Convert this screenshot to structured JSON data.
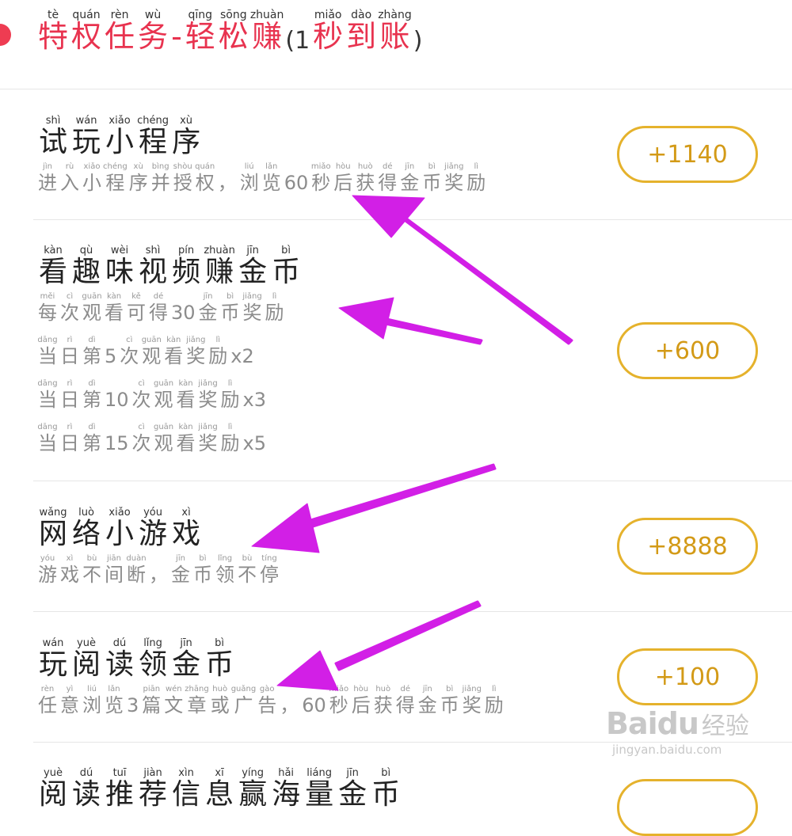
{
  "header": {
    "title_chars": [
      {
        "py": "tè",
        "hz": "特"
      },
      {
        "py": "quán",
        "hz": "权"
      },
      {
        "py": "rèn",
        "hz": "任"
      },
      {
        "py": "wù",
        "hz": "务"
      },
      {
        "py": "",
        "hz": "-"
      },
      {
        "py": "qīng",
        "hz": "轻"
      },
      {
        "py": "sōng",
        "hz": "松"
      },
      {
        "py": "zhuàn",
        "hz": "赚"
      }
    ],
    "tail_open": "(1",
    "tail_chars": [
      {
        "py": "miǎo",
        "hz": "秒"
      },
      {
        "py": "dào",
        "hz": "到"
      },
      {
        "py": "zhàng",
        "hz": "账"
      }
    ],
    "tail_close": ")"
  },
  "tasks": [
    {
      "title_chars": [
        {
          "py": "shì",
          "hz": "试"
        },
        {
          "py": "wán",
          "hz": "玩"
        },
        {
          "py": "xiǎo",
          "hz": "小"
        },
        {
          "py": "chéng",
          "hz": "程"
        },
        {
          "py": "xù",
          "hz": "序"
        }
      ],
      "desc_lines": [
        [
          {
            "py": "jìn",
            "hz": "进"
          },
          {
            "py": "rù",
            "hz": "入"
          },
          {
            "py": "xiǎo",
            "hz": "小"
          },
          {
            "py": "chéng",
            "hz": "程"
          },
          {
            "py": "xù",
            "hz": "序"
          },
          {
            "py": "bìng",
            "hz": "并"
          },
          {
            "py": "shòu",
            "hz": "授"
          },
          {
            "py": "quán",
            "hz": "权"
          },
          {
            "py": "",
            "hz": "，"
          },
          {
            "py": "liú",
            "hz": "浏"
          },
          {
            "py": "lǎn",
            "hz": "览"
          },
          {
            "py": "",
            "hz": "60"
          },
          {
            "py": "miǎo",
            "hz": "秒"
          },
          {
            "py": "hòu",
            "hz": "后"
          },
          {
            "py": "huò",
            "hz": "获"
          },
          {
            "py": "dé",
            "hz": "得"
          },
          {
            "py": "jīn",
            "hz": "金"
          },
          {
            "py": "bì",
            "hz": "币"
          },
          {
            "py": "jiǎng",
            "hz": "奖"
          },
          {
            "py": "lì",
            "hz": "励"
          }
        ]
      ],
      "reward": "+1140"
    },
    {
      "title_chars": [
        {
          "py": "kàn",
          "hz": "看"
        },
        {
          "py": "qù",
          "hz": "趣"
        },
        {
          "py": "wèi",
          "hz": "味"
        },
        {
          "py": "shì",
          "hz": "视"
        },
        {
          "py": "pín",
          "hz": "频"
        },
        {
          "py": "zhuàn",
          "hz": "赚"
        },
        {
          "py": "jīn",
          "hz": "金"
        },
        {
          "py": "bì",
          "hz": "币"
        }
      ],
      "desc_lines": [
        [
          {
            "py": "měi",
            "hz": "每"
          },
          {
            "py": "cì",
            "hz": "次"
          },
          {
            "py": "guān",
            "hz": "观"
          },
          {
            "py": "kàn",
            "hz": "看"
          },
          {
            "py": "kě",
            "hz": "可"
          },
          {
            "py": "dé",
            "hz": "得"
          },
          {
            "py": "",
            "hz": "30"
          },
          {
            "py": "jīn",
            "hz": "金"
          },
          {
            "py": "bì",
            "hz": "币"
          },
          {
            "py": "jiǎng",
            "hz": "奖"
          },
          {
            "py": "lì",
            "hz": "励"
          }
        ],
        [
          {
            "py": "dāng",
            "hz": "当"
          },
          {
            "py": "rì",
            "hz": "日"
          },
          {
            "py": "dì",
            "hz": "第"
          },
          {
            "py": "",
            "hz": "5"
          },
          {
            "py": "cì",
            "hz": "次"
          },
          {
            "py": "guān",
            "hz": "观"
          },
          {
            "py": "kàn",
            "hz": "看"
          },
          {
            "py": "jiǎng",
            "hz": "奖"
          },
          {
            "py": "lì",
            "hz": "励"
          },
          {
            "py": "",
            "hz": "x2"
          }
        ],
        [
          {
            "py": "dāng",
            "hz": "当"
          },
          {
            "py": "rì",
            "hz": "日"
          },
          {
            "py": "dì",
            "hz": "第"
          },
          {
            "py": "",
            "hz": "10"
          },
          {
            "py": "cì",
            "hz": "次"
          },
          {
            "py": "guān",
            "hz": "观"
          },
          {
            "py": "kàn",
            "hz": "看"
          },
          {
            "py": "jiǎng",
            "hz": "奖"
          },
          {
            "py": "lì",
            "hz": "励"
          },
          {
            "py": "",
            "hz": "x3"
          }
        ],
        [
          {
            "py": "dāng",
            "hz": "当"
          },
          {
            "py": "rì",
            "hz": "日"
          },
          {
            "py": "dì",
            "hz": "第"
          },
          {
            "py": "",
            "hz": "15"
          },
          {
            "py": "cì",
            "hz": "次"
          },
          {
            "py": "guān",
            "hz": "观"
          },
          {
            "py": "kàn",
            "hz": "看"
          },
          {
            "py": "jiǎng",
            "hz": "奖"
          },
          {
            "py": "lì",
            "hz": "励"
          },
          {
            "py": "",
            "hz": "x5"
          }
        ]
      ],
      "reward": "+600"
    },
    {
      "title_chars": [
        {
          "py": "wǎng",
          "hz": "网"
        },
        {
          "py": "luò",
          "hz": "络"
        },
        {
          "py": "xiǎo",
          "hz": "小"
        },
        {
          "py": "yóu",
          "hz": "游"
        },
        {
          "py": "xì",
          "hz": "戏"
        }
      ],
      "desc_lines": [
        [
          {
            "py": "yóu",
            "hz": "游"
          },
          {
            "py": "xì",
            "hz": "戏"
          },
          {
            "py": "bù",
            "hz": "不"
          },
          {
            "py": "jiān",
            "hz": "间"
          },
          {
            "py": "duàn",
            "hz": "断"
          },
          {
            "py": "",
            "hz": "，"
          },
          {
            "py": "jīn",
            "hz": "金"
          },
          {
            "py": "bì",
            "hz": "币"
          },
          {
            "py": "lǐng",
            "hz": "领"
          },
          {
            "py": "bù",
            "hz": "不"
          },
          {
            "py": "tíng",
            "hz": "停"
          }
        ]
      ],
      "reward": "+8888"
    },
    {
      "title_chars": [
        {
          "py": "wán",
          "hz": "玩"
        },
        {
          "py": "yuè",
          "hz": "阅"
        },
        {
          "py": "dú",
          "hz": "读"
        },
        {
          "py": "lǐng",
          "hz": "领"
        },
        {
          "py": "jīn",
          "hz": "金"
        },
        {
          "py": "bì",
          "hz": "币"
        }
      ],
      "desc_lines": [
        [
          {
            "py": "rèn",
            "hz": "任"
          },
          {
            "py": "yì",
            "hz": "意"
          },
          {
            "py": "liú",
            "hz": "浏"
          },
          {
            "py": "lǎn",
            "hz": "览"
          },
          {
            "py": "",
            "hz": "3"
          },
          {
            "py": "piān",
            "hz": "篇"
          },
          {
            "py": "wén",
            "hz": "文"
          },
          {
            "py": "zhāng",
            "hz": "章"
          },
          {
            "py": "huò",
            "hz": "或"
          },
          {
            "py": "guǎng",
            "hz": "广"
          },
          {
            "py": "gào",
            "hz": "告"
          },
          {
            "py": "",
            "hz": "，"
          },
          {
            "py": "",
            "hz": "60"
          },
          {
            "py": "miǎo",
            "hz": "秒"
          },
          {
            "py": "hòu",
            "hz": "后"
          },
          {
            "py": "huò",
            "hz": "获"
          },
          {
            "py": "dé",
            "hz": "得"
          },
          {
            "py": "jīn",
            "hz": "金"
          },
          {
            "py": "bì",
            "hz": "币"
          },
          {
            "py": "jiǎng",
            "hz": "奖"
          },
          {
            "py": "lì",
            "hz": "励"
          }
        ]
      ],
      "reward": "+100"
    },
    {
      "title_chars": [
        {
          "py": "yuè",
          "hz": "阅"
        },
        {
          "py": "dú",
          "hz": "读"
        },
        {
          "py": "tuī",
          "hz": "推"
        },
        {
          "py": "jiàn",
          "hz": "荐"
        },
        {
          "py": "xìn",
          "hz": "信"
        },
        {
          "py": "xī",
          "hz": "息"
        },
        {
          "py": "yíng",
          "hz": "赢"
        },
        {
          "py": "hǎi",
          "hz": "海"
        },
        {
          "py": "liáng",
          "hz": "量"
        },
        {
          "py": "jīn",
          "hz": "金"
        },
        {
          "py": "bì",
          "hz": "币"
        }
      ],
      "desc_lines": [],
      "reward": ""
    }
  ],
  "watermark": {
    "logo": "Baidu",
    "cn": "经验",
    "url": "jingyan.baidu.com"
  },
  "colors": {
    "accent_red": "#e8334f",
    "reward_gold": "#e5b22c",
    "annotation_magenta": "#d21fe6"
  }
}
